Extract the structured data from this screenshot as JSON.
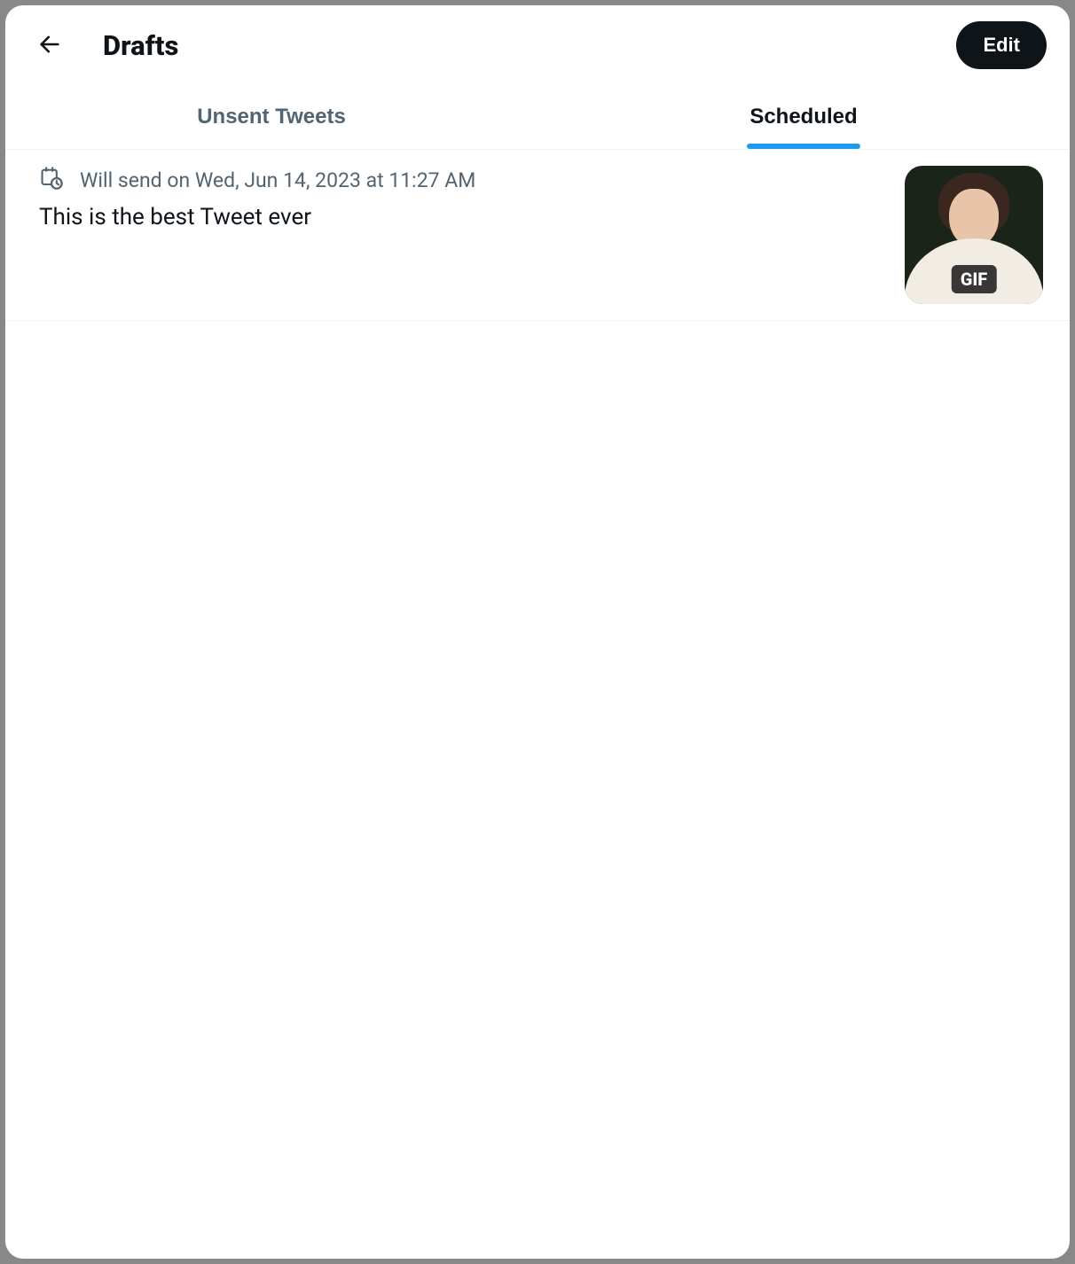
{
  "header": {
    "title": "Drafts",
    "edit_label": "Edit"
  },
  "tabs": {
    "unsent_label": "Unsent Tweets",
    "scheduled_label": "Scheduled",
    "active": "scheduled"
  },
  "drafts": [
    {
      "schedule_text": "Will send on Wed, Jun 14, 2023 at 11:27 AM",
      "tweet_text": "This is the best Tweet ever",
      "media_badge": "GIF"
    }
  ]
}
